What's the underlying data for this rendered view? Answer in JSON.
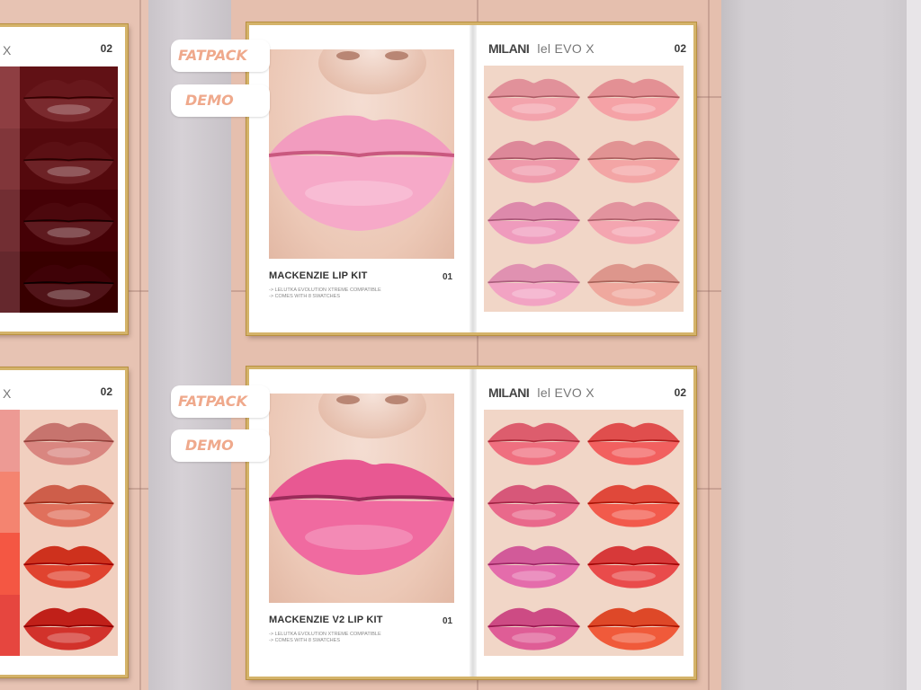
{
  "tags": {
    "fatpack": "FATPACK",
    "demo": "DEMO"
  },
  "boards": [
    {
      "product_title": "MACKENZIE LIP KIT",
      "page_left": "01",
      "page_right": "02",
      "notes": [
        "-> LELUTKA EVOLUTION XTREME COMPATIBLE",
        "-> COMES WITH 8 SWATCHES"
      ],
      "brand": "MILANI",
      "brand_sep": "lel",
      "brand_line": "EVO X",
      "hero_lip": {
        "top": "#f29cbf",
        "bottom": "#f6a9c8",
        "line": "#c9587f"
      },
      "swatches": [
        "#f3a3ac",
        "#f5a2a6",
        "#ef9aab",
        "#f3a5a5",
        "#ef9bbd",
        "#f4a5b0",
        "#f2a3c3",
        "#efa89e"
      ]
    },
    {
      "product_title": "MACKENZIE V2 LIP KIT",
      "page_left": "01",
      "page_right": "02",
      "notes": [
        "-> LELUTKA EVOLUTION XTREME COMPATIBLE",
        "-> COMES WITH 8 SWATCHES"
      ],
      "brand": "MILANI",
      "brand_sep": "lel",
      "brand_line": "EVO X",
      "hero_lip": {
        "top": "#e85892",
        "bottom": "#f06aa0",
        "line": "#9c2a5a"
      },
      "swatches": [
        "#ef6f7f",
        "#f2605f",
        "#e9698b",
        "#f25a4c",
        "#e46cab",
        "#e94b4b",
        "#df5d96",
        "#f05a3a"
      ]
    }
  ],
  "partial_boards": [
    {
      "brand_tail": "X",
      "page_right": "02",
      "swatches": [
        "#7a2a2e",
        "#6d2226",
        "#5e1a1f",
        "#511419"
      ]
    },
    {
      "brand_tail": "X",
      "page_right": "02",
      "swatches": [
        "#d98680",
        "#e0705c",
        "#e0432f",
        "#d2322b"
      ]
    }
  ],
  "colors": {
    "wall_pink": "#e7c3b3",
    "frame_gold": "#d4b36a",
    "tag_text": "#efa98c"
  }
}
